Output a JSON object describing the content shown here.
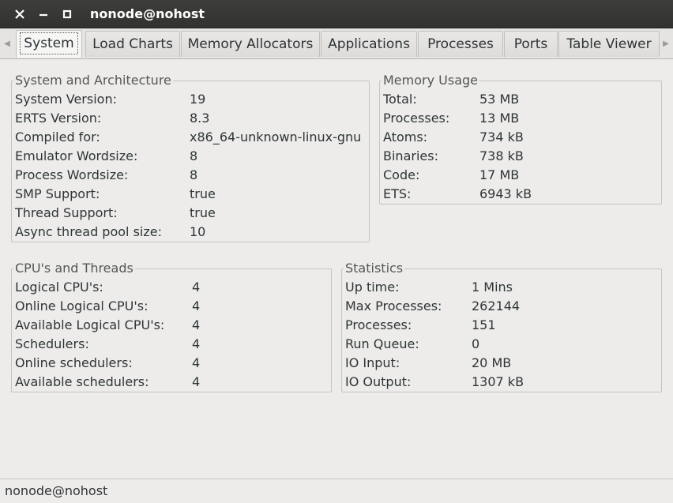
{
  "window": {
    "title": "nonode@nohost",
    "close_icon": "close-icon",
    "minimize_icon": "minimize-icon",
    "maximize_icon": "maximize-icon"
  },
  "tabs": [
    {
      "label": "System",
      "active": true
    },
    {
      "label": "Load Charts"
    },
    {
      "label": "Memory Allocators"
    },
    {
      "label": "Applications"
    },
    {
      "label": "Processes"
    },
    {
      "label": "Ports"
    },
    {
      "label": "Table Viewer"
    }
  ],
  "system_arch": {
    "title": "System and Architecture",
    "rows": [
      {
        "label": "System Version:",
        "value": "19"
      },
      {
        "label": "ERTS Version:",
        "value": "8.3"
      },
      {
        "label": "Compiled for:",
        "value": "x86_64-unknown-linux-gnu"
      },
      {
        "label": "Emulator Wordsize:",
        "value": "8"
      },
      {
        "label": "Process Wordsize:",
        "value": "8"
      },
      {
        "label": "SMP Support:",
        "value": "true"
      },
      {
        "label": "Thread Support:",
        "value": "true"
      },
      {
        "label": "Async thread pool size:",
        "value": "10"
      }
    ]
  },
  "memory_usage": {
    "title": "Memory Usage",
    "rows": [
      {
        "label": "Total:",
        "value": "53 MB"
      },
      {
        "label": "Processes:",
        "value": "13 MB"
      },
      {
        "label": "Atoms:",
        "value": "734 kB"
      },
      {
        "label": "Binaries:",
        "value": "738 kB"
      },
      {
        "label": "Code:",
        "value": "17 MB"
      },
      {
        "label": "ETS:",
        "value": "6943 kB"
      }
    ]
  },
  "cpus_threads": {
    "title": "CPU's and Threads",
    "rows": [
      {
        "label": "Logical CPU's:",
        "value": "4"
      },
      {
        "label": "Online Logical CPU's:",
        "value": "4"
      },
      {
        "label": "Available Logical CPU's:",
        "value": "4"
      },
      {
        "label": "Schedulers:",
        "value": "4"
      },
      {
        "label": "Online schedulers:",
        "value": "4"
      },
      {
        "label": "Available schedulers:",
        "value": "4"
      }
    ]
  },
  "statistics": {
    "title": "Statistics",
    "rows": [
      {
        "label": "Up time:",
        "value": "1 Mins"
      },
      {
        "label": "Max Processes:",
        "value": "262144"
      },
      {
        "label": "Processes:",
        "value": "151"
      },
      {
        "label": "Run Queue:",
        "value": "0"
      },
      {
        "label": "IO Input:",
        "value": "20 MB"
      },
      {
        "label": "IO Output:",
        "value": "1307 kB"
      }
    ]
  },
  "statusbar": {
    "text": "nonode@nohost"
  }
}
